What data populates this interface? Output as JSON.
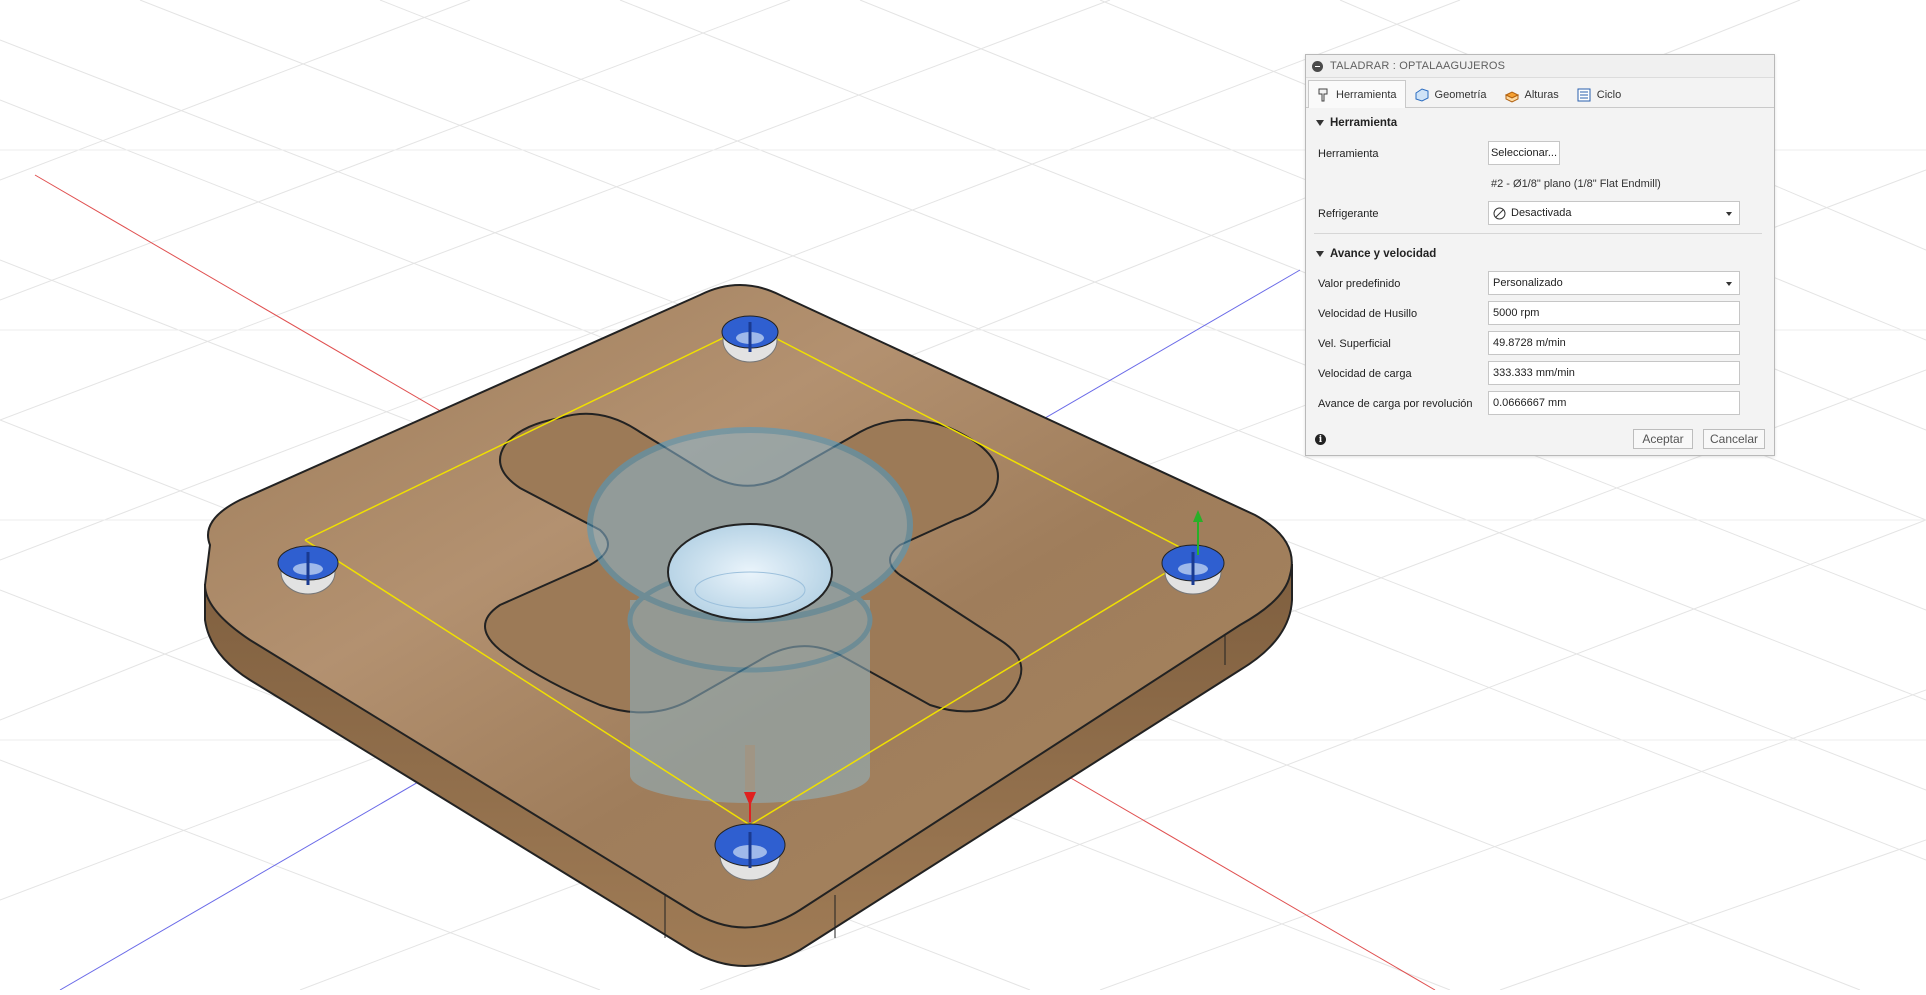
{
  "dialog": {
    "title": "TALADRAR : OPTALAAGUJEROS",
    "tabs": [
      {
        "label": "Herramienta",
        "icon": "drill-tool-icon",
        "active": true
      },
      {
        "label": "Geometría",
        "icon": "geometry-icon",
        "active": false
      },
      {
        "label": "Alturas",
        "icon": "heights-icon",
        "active": false
      },
      {
        "label": "Ciclo",
        "icon": "cycle-icon",
        "active": false
      }
    ],
    "tool_section": {
      "heading": "Herramienta",
      "tool_label": "Herramienta",
      "select_button": "Seleccionar...",
      "tool_description": "#2 - Ø1/8\" plano (1/8\" Flat Endmill)",
      "coolant_label": "Refrigerante",
      "coolant_value": "Desactivada",
      "coolant_icon": "disabled-icon"
    },
    "feed_section": {
      "heading": "Avance y velocidad",
      "preset_label": "Valor predefinido",
      "preset_value": "Personalizado",
      "spindle_label": "Velocidad de Husillo",
      "spindle_value": "5000 rpm",
      "surface_label": "Vel. Superficial",
      "surface_value": "49.8728 m/min",
      "feed_label": "Velocidad de carga",
      "feed_value": "333.333 mm/min",
      "feed_per_rev_label": "Avance de carga por revolución",
      "feed_per_rev_value": "0.0666667 mm"
    },
    "footer": {
      "info_icon": "info-icon",
      "accept": "Aceptar",
      "cancel": "Cancelar"
    }
  },
  "colors": {
    "wood": "#a98660",
    "wood_edge": "#8c6a46",
    "hole_blue": "#2f5fd0",
    "ghost_blue": "#6fa8c8",
    "grid": "#e3e3e3",
    "x_axis": "#e05050",
    "y_axis": "#6a6ae8",
    "toolpath": "#f0e000"
  }
}
